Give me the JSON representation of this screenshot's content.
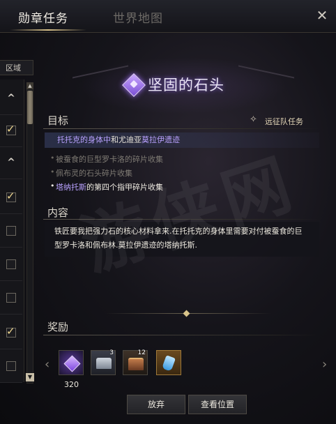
{
  "header": {
    "tabs": [
      {
        "label": "勋章任务",
        "active": true
      },
      {
        "label": "世界地图",
        "active": false
      }
    ],
    "close_glyph": "✕"
  },
  "sidebar": {
    "region_label": "区域",
    "rows": [
      {
        "type": "chevron",
        "glyph": "^"
      },
      {
        "type": "checkbox",
        "checked": true
      },
      {
        "type": "chevron",
        "glyph": "^"
      },
      {
        "type": "checkbox",
        "checked": true
      },
      {
        "type": "checkbox",
        "checked": false
      },
      {
        "type": "checkbox",
        "checked": false
      },
      {
        "type": "checkbox",
        "checked": false
      },
      {
        "type": "checkbox",
        "checked": true
      },
      {
        "type": "checkbox",
        "checked": false
      }
    ]
  },
  "quest": {
    "title": "坚固的石头",
    "icon": "quest-rune-icon",
    "accent_color": "#a07cf0"
  },
  "objectives": {
    "section_title": "目标",
    "quest_type_label": "远征队任务",
    "main": {
      "part1": "托托克的身体中",
      "part2": "和尤迪亚",
      "part3": "莫拉伊遗迹"
    },
    "sub": [
      {
        "text": "被蚕食的巨型罗卡洛的碎片收集",
        "active": false
      },
      {
        "text": "佩布灵的石头碎片收集",
        "active": false
      },
      {
        "name_part": "塔纳托斯",
        "rest_part": "的第四个指甲碎片收集",
        "active": true
      }
    ]
  },
  "content": {
    "section_title": "内容",
    "description": "铁匠要我把强力石的核心材料拿来.在托托克的身体里需要对付被蚕食的巨型罗卡洛和佩布林.莫拉伊遗迹的塔纳托斯."
  },
  "rewards": {
    "section_title": "奖励",
    "items": [
      {
        "icon": "purple-medal-icon",
        "count": ""
      },
      {
        "icon": "silver-chest-icon",
        "count": "3"
      },
      {
        "icon": "wooden-chest-icon",
        "count": "12"
      },
      {
        "icon": "blue-potion-icon",
        "count": ""
      }
    ],
    "first_value": "320",
    "prev_glyph": "‹",
    "next_glyph": "›"
  },
  "buttons": {
    "abandon": "放弃",
    "view_location": "查看位置"
  },
  "watermark": "游侠网"
}
